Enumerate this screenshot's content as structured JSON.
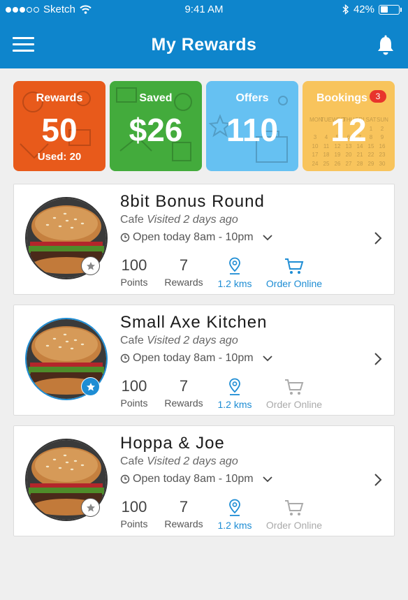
{
  "status_bar": {
    "carrier": "Sketch",
    "time": "9:41 AM",
    "battery": "42%",
    "battery_level": 0.42
  },
  "header": {
    "title": "My Rewards",
    "menu_icon": "hamburger-menu-icon",
    "notification_icon": "bell-icon"
  },
  "tiles": [
    {
      "label": "Rewards",
      "value": "50",
      "sub": "Used: 20",
      "color": "#e85a1b"
    },
    {
      "label": "Saved",
      "value": "$26",
      "color": "#43ab3c"
    },
    {
      "label": "Offers",
      "value": "110",
      "color": "#66c1f2"
    },
    {
      "label": "Bookings",
      "value": "12",
      "badge": "3",
      "color": "#f8c45c",
      "calendar": {
        "weekdays": [
          "MON",
          "TUE",
          "WED",
          "THU",
          "FRI",
          "SAT",
          "SUN"
        ],
        "weeks": [
          [
            "",
            "",
            "",
            "",
            "",
            "1",
            "2"
          ],
          [
            "3",
            "4",
            "5",
            "6",
            "7",
            "8",
            "9"
          ],
          [
            "10",
            "11",
            "12",
            "13",
            "14",
            "15",
            "16"
          ],
          [
            "17",
            "18",
            "19",
            "20",
            "21",
            "22",
            "23"
          ],
          [
            "24",
            "25",
            "26",
            "27",
            "28",
            "29",
            "30"
          ]
        ]
      }
    }
  ],
  "venues": [
    {
      "name": "8bit Bonus Round",
      "category": "Cafe",
      "visited": "Visited 2 days ago",
      "hours": "Open today 8am - 10pm",
      "points": "100",
      "points_label": "Points",
      "rewards": "7",
      "rewards_label": "Rewards",
      "distance": "1.2 kms",
      "order_label": "Order Online",
      "order_enabled": true,
      "favorite": false
    },
    {
      "name": "Small Axe Kitchen",
      "category": "Cafe",
      "visited": "Visited 2 days ago",
      "hours": "Open today 8am - 10pm",
      "points": "100",
      "points_label": "Points",
      "rewards": "7",
      "rewards_label": "Rewards",
      "distance": "1.2 kms",
      "order_label": "Order Online",
      "order_enabled": false,
      "favorite": true
    },
    {
      "name": "Hoppa & Joe",
      "category": "Cafe",
      "visited": "Visited 2 days ago",
      "hours": "Open today 8am - 10pm",
      "points": "100",
      "points_label": "Points",
      "rewards": "7",
      "rewards_label": "Rewards",
      "distance": "1.2 kms",
      "order_label": "Order Online",
      "order_enabled": false,
      "favorite": false
    }
  ],
  "colors": {
    "primary": "#0e85cc",
    "accent": "#1e8dd4",
    "badge": "#e8342c"
  }
}
